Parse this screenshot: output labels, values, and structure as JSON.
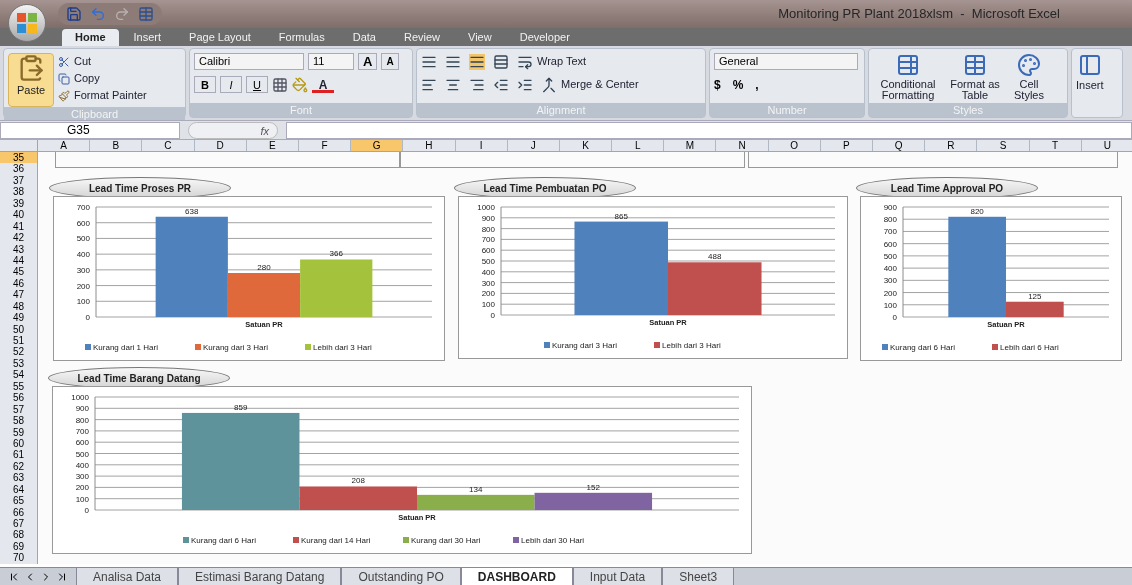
{
  "window": {
    "title": "Monitoring PR Plant 2018xlsm  -  Microsoft Excel"
  },
  "ribbon_tabs": [
    {
      "label": "Home",
      "selected": true
    },
    {
      "label": "Insert",
      "selected": false
    },
    {
      "label": "Page Layout",
      "selected": false
    },
    {
      "label": "Formulas",
      "selected": false
    },
    {
      "label": "Data",
      "selected": false
    },
    {
      "label": "Review",
      "selected": false
    },
    {
      "label": "View",
      "selected": false
    },
    {
      "label": "Developer",
      "selected": false
    }
  ],
  "clipboard": {
    "paste": "Paste",
    "cut": "Cut",
    "copy": "Copy",
    "format_painter": "Format Painter",
    "label": "Clipboard"
  },
  "font": {
    "name": "Calibri",
    "size": "11",
    "bold": "B",
    "italic": "I",
    "underline": "U",
    "font_color": "A",
    "grow": "A",
    "shrink": "A",
    "label": "Font"
  },
  "alignment": {
    "wrap_text": "Wrap Text",
    "merge": "Merge & Center",
    "label": "Alignment"
  },
  "number": {
    "format": "General",
    "currency": "$",
    "percent": "%",
    "comma": ",",
    "label": "Number"
  },
  "styles": {
    "conditional": "Conditional Formatting",
    "format_table": "Format as Table",
    "cell_styles": "Cell Styles",
    "label": "Styles"
  },
  "cells": {
    "insert": "Insert"
  },
  "formula_bar": {
    "name_box": "G35",
    "fx": "fx"
  },
  "columns": [
    {
      "label": "A",
      "selected": false
    },
    {
      "label": "B",
      "selected": false
    },
    {
      "label": "C",
      "selected": false
    },
    {
      "label": "D",
      "selected": false
    },
    {
      "label": "E",
      "selected": false
    },
    {
      "label": "F",
      "selected": false
    },
    {
      "label": "G",
      "selected": true
    },
    {
      "label": "H",
      "selected": false
    },
    {
      "label": "I",
      "selected": false
    },
    {
      "label": "J",
      "selected": false
    },
    {
      "label": "K",
      "selected": false
    },
    {
      "label": "L",
      "selected": false
    },
    {
      "label": "M",
      "selected": false
    },
    {
      "label": "N",
      "selected": false
    },
    {
      "label": "O",
      "selected": false
    },
    {
      "label": "P",
      "selected": false
    },
    {
      "label": "Q",
      "selected": false
    },
    {
      "label": "R",
      "selected": false
    },
    {
      "label": "S",
      "selected": false
    },
    {
      "label": "T",
      "selected": false
    },
    {
      "label": "U",
      "selected": false
    }
  ],
  "rows": [
    {
      "label": "35",
      "selected": true
    },
    {
      "label": "36",
      "selected": false
    },
    {
      "label": "37",
      "selected": false
    },
    {
      "label": "38",
      "selected": false
    },
    {
      "label": "39",
      "selected": false
    },
    {
      "label": "40",
      "selected": false
    },
    {
      "label": "41",
      "selected": false
    },
    {
      "label": "42",
      "selected": false
    },
    {
      "label": "43",
      "selected": false
    },
    {
      "label": "44",
      "selected": false
    },
    {
      "label": "45",
      "selected": false
    },
    {
      "label": "46",
      "selected": false
    },
    {
      "label": "47",
      "selected": false
    },
    {
      "label": "48",
      "selected": false
    },
    {
      "label": "49",
      "selected": false
    },
    {
      "label": "50",
      "selected": false
    },
    {
      "label": "51",
      "selected": false
    },
    {
      "label": "52",
      "selected": false
    },
    {
      "label": "53",
      "selected": false
    },
    {
      "label": "54",
      "selected": false
    },
    {
      "label": "55",
      "selected": false
    },
    {
      "label": "56",
      "selected": false
    },
    {
      "label": "57",
      "selected": false
    },
    {
      "label": "58",
      "selected": false
    },
    {
      "label": "59",
      "selected": false
    },
    {
      "label": "60",
      "selected": false
    },
    {
      "label": "61",
      "selected": false
    },
    {
      "label": "62",
      "selected": false
    },
    {
      "label": "63",
      "selected": false
    },
    {
      "label": "64",
      "selected": false
    },
    {
      "label": "65",
      "selected": false
    },
    {
      "label": "66",
      "selected": false
    },
    {
      "label": "67",
      "selected": false
    },
    {
      "label": "68",
      "selected": false
    },
    {
      "label": "69",
      "selected": false
    },
    {
      "label": "70",
      "selected": false
    }
  ],
  "charts": [
    {
      "title": "Lead Time Proses PR",
      "chart_data": {
        "type": "bar",
        "grid": true,
        "legend": true,
        "categories": [
          "Satuan PR"
        ],
        "ylim": [
          0,
          700
        ],
        "yticks": [
          0,
          100,
          200,
          300,
          400,
          500,
          600,
          700
        ],
        "data_labels": true,
        "series": [
          {
            "name": "Kurang dari 1 Hari",
            "color": "#4f81bd",
            "values": [
              638
            ]
          },
          {
            "name": "Kurang dari 3 Hari",
            "color": "#e0693c",
            "values": [
              280
            ]
          },
          {
            "name": "Lebih dari 3 Hari",
            "color": "#a4c23c",
            "values": [
              366
            ]
          }
        ]
      }
    },
    {
      "title": "Lead Time Pembuatan PO",
      "chart_data": {
        "type": "bar",
        "grid": true,
        "legend": true,
        "categories": [
          "Satuan PR"
        ],
        "ylim": [
          0,
          1000
        ],
        "yticks": [
          0,
          100,
          200,
          300,
          400,
          500,
          600,
          700,
          800,
          900,
          1000
        ],
        "data_labels": true,
        "series": [
          {
            "name": "Kurang dari 3 Hari",
            "color": "#4f81bd",
            "values": [
              865
            ]
          },
          {
            "name": "Lebih dari 3 Hari",
            "color": "#c0504d",
            "values": [
              488
            ]
          }
        ]
      }
    },
    {
      "title": "Lead Time Approval PO",
      "chart_data": {
        "type": "bar",
        "grid": true,
        "legend": true,
        "categories": [
          "Satuan PR"
        ],
        "ylim": [
          0,
          900
        ],
        "yticks": [
          0,
          100,
          200,
          300,
          400,
          500,
          600,
          700,
          800,
          900
        ],
        "data_labels": true,
        "series": [
          {
            "name": "Kurang dari 6 Hari",
            "color": "#4f81bd",
            "values": [
              820
            ]
          },
          {
            "name": "Lebih dari 6 Hari",
            "color": "#c0504d",
            "values": [
              125
            ]
          }
        ]
      }
    },
    {
      "title": "Lead Time Barang Datang",
      "chart_data": {
        "type": "bar",
        "grid": true,
        "legend": true,
        "categories": [
          "Satuan PR"
        ],
        "ylim": [
          0,
          1000
        ],
        "yticks": [
          0,
          100,
          200,
          300,
          400,
          500,
          600,
          700,
          800,
          900,
          1000
        ],
        "data_labels": true,
        "series": [
          {
            "name": "Kurang dari 6 Hari",
            "color": "#5f939b",
            "values": [
              859
            ]
          },
          {
            "name": "Kurang dari 14 Hari",
            "color": "#c0504d",
            "values": [
              208
            ]
          },
          {
            "name": "Kurang dari 30 Hari",
            "color": "#8aae4a",
            "values": [
              134
            ]
          },
          {
            "name": "Lebih dari 30 Hari",
            "color": "#8064a2",
            "values": [
              152
            ]
          }
        ]
      }
    }
  ],
  "sheet_tabs": [
    {
      "label": "Analisa Data",
      "selected": false
    },
    {
      "label": "Estimasi Barang Datang",
      "selected": false
    },
    {
      "label": "Outstanding PO",
      "selected": false
    },
    {
      "label": "DASHBOARD",
      "selected": true
    },
    {
      "label": "Input Data",
      "selected": false
    },
    {
      "label": "Sheet3",
      "selected": false
    }
  ]
}
